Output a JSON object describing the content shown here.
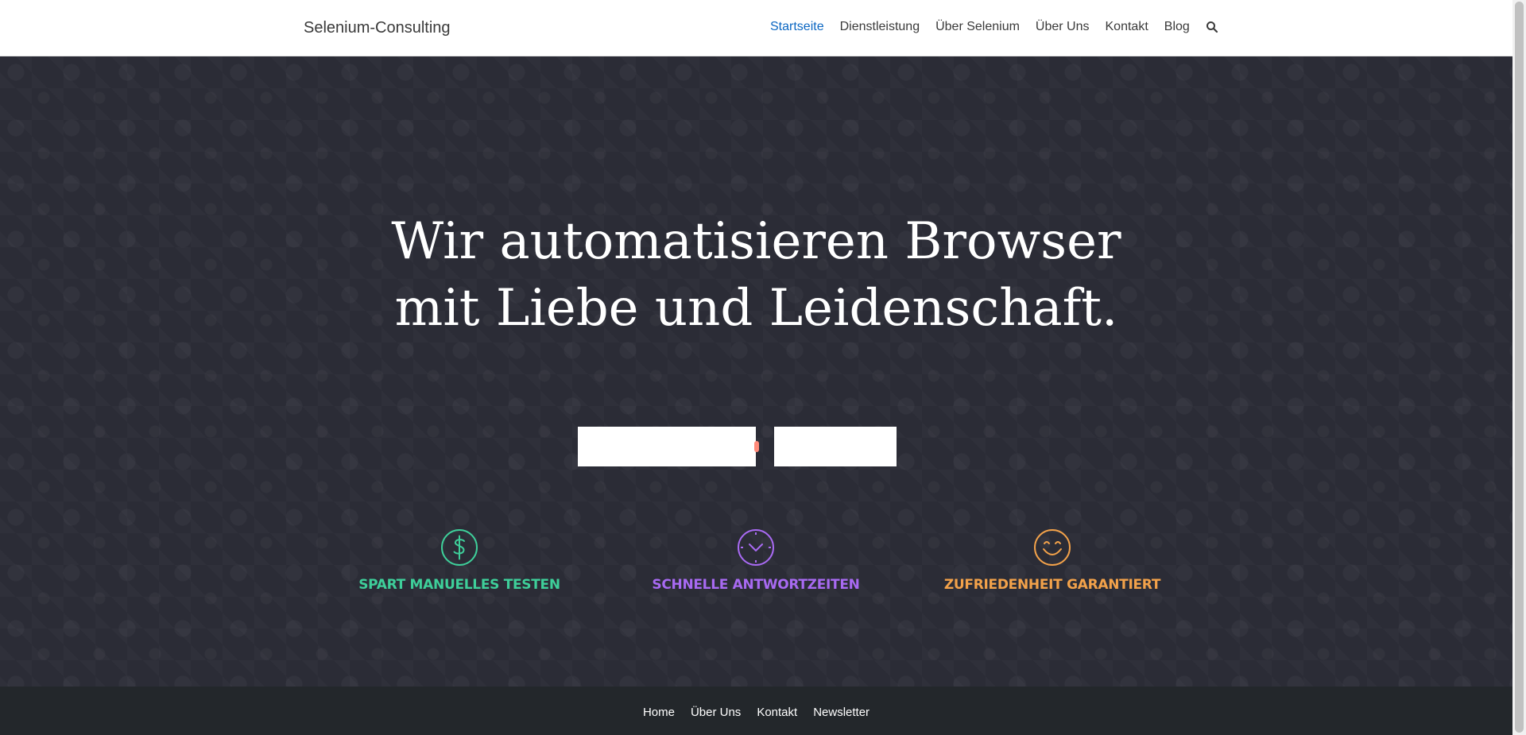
{
  "header": {
    "brand": "Selenium-Consulting",
    "nav": [
      {
        "label": "Startseite",
        "active": true
      },
      {
        "label": "Dienstleistung",
        "active": false
      },
      {
        "label": "Über Selenium",
        "active": false
      },
      {
        "label": "Über Uns",
        "active": false
      },
      {
        "label": "Kontakt",
        "active": false
      },
      {
        "label": "Blog",
        "active": false
      }
    ],
    "search_icon": "search-icon",
    "accent_color": "#0a66c2"
  },
  "hero": {
    "headline_line1": "Wir automatisieren Browser",
    "headline_line2": "mit Liebe und Leidenschaft.",
    "background_color": "#2b2c36",
    "features": [
      {
        "icon": "dollar-icon",
        "label": "SPART MANUELLES TESTEN",
        "color": "#3ecf9a"
      },
      {
        "icon": "clock-icon",
        "label": "SCHNELLE ANTWORTZEITEN",
        "color": "#a86af2"
      },
      {
        "icon": "smile-icon",
        "label": "ZUFRIEDENHEIT GARANTIERT",
        "color": "#f3a24a"
      }
    ]
  },
  "footer": {
    "links": [
      "Home",
      "Über Uns",
      "Kontakt",
      "Newsletter"
    ],
    "background_color": "#23272b"
  }
}
